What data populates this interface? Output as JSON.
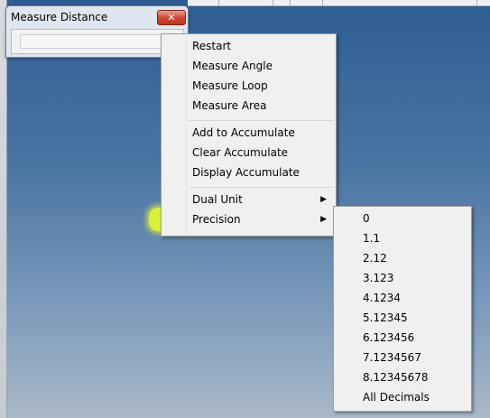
{
  "dialog": {
    "title": "Measure Distance",
    "close_glyph": "✕",
    "close_icon": "close-icon"
  },
  "context_menu": {
    "items": [
      {
        "label": "Restart"
      },
      {
        "label": "Measure Angle"
      },
      {
        "label": "Measure Loop"
      },
      {
        "label": "Measure Area"
      },
      {
        "label": "Add to Accumulate"
      },
      {
        "label": "Clear Accumulate"
      },
      {
        "label": "Display Accumulate"
      },
      {
        "label": "Dual Unit",
        "submenu_arrow": "▶"
      },
      {
        "label": "Precision",
        "submenu_arrow": "▶"
      }
    ]
  },
  "precision_submenu": {
    "items": [
      "0",
      "1.1",
      "2.12",
      "3.123",
      "4.1234",
      "5.12345",
      "6.123456",
      "7.1234567",
      "8.12345678",
      "All Decimals"
    ]
  },
  "colors": {
    "highlight": "#ecff28",
    "desktop_top": "#2f5d92",
    "desktop_bottom": "#aab9c9"
  }
}
